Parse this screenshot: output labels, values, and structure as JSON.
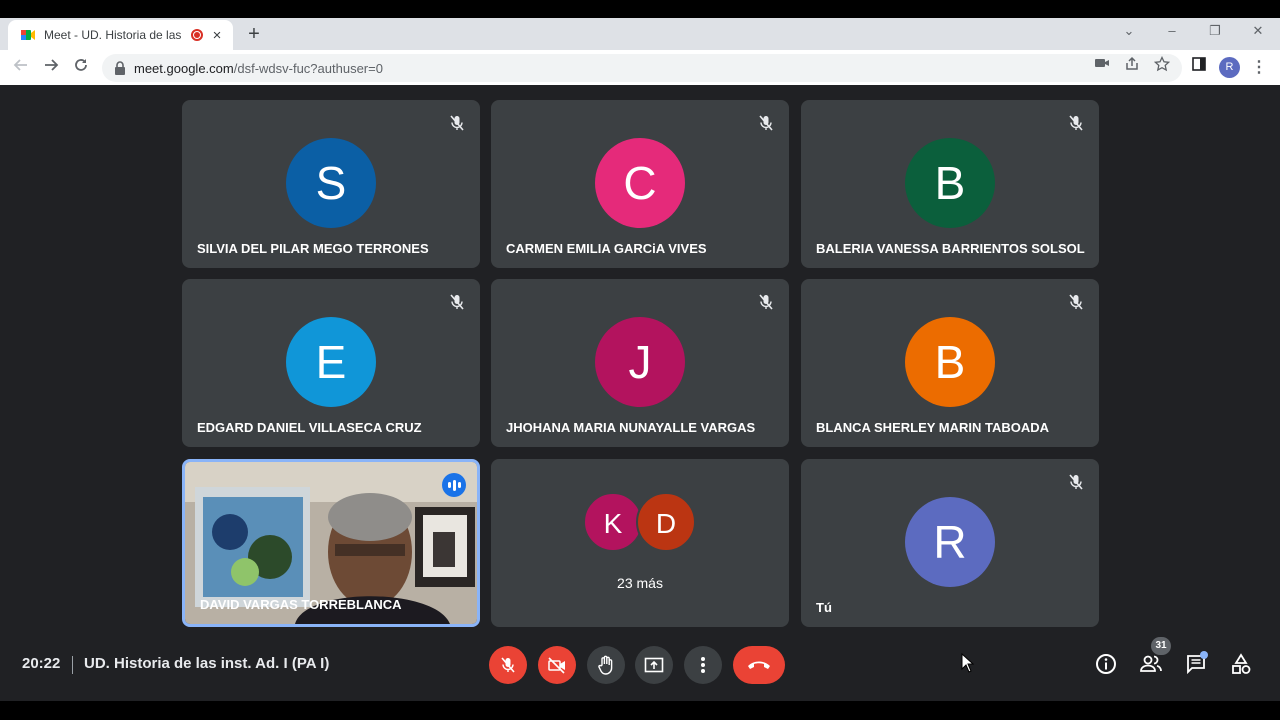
{
  "browser": {
    "tab_title": "Meet - UD. Historia de las in",
    "tab_close": "×",
    "new_tab": "+",
    "url_host": "meet.google.com",
    "url_path": "/dsf-wdsv-fuc?authuser=0",
    "profile_initial": "R",
    "window_controls": [
      "⌄",
      "–",
      "❐",
      "✕"
    ]
  },
  "participants": [
    {
      "name": "SILVIA DEL PILAR MEGO TERRONES",
      "initial": "S",
      "color": "#0b5fa5",
      "muted": true
    },
    {
      "name": "CARMEN EMILIA GARCiA VIVES",
      "initial": "C",
      "color": "#e52a7a",
      "muted": true
    },
    {
      "name": "BALERIA VANESSA BARRIENTOS SOLSOL",
      "initial": "B",
      "color": "#0b5f3c",
      "muted": true
    },
    {
      "name": "EDGARD DANIEL VILLASECA CRUZ",
      "initial": "E",
      "color": "#1096d8",
      "muted": true
    },
    {
      "name": "JHOHANA MARIA NUNAYALLE VARGAS",
      "initial": "J",
      "color": "#b3135e",
      "muted": true
    },
    {
      "name": "BLANCA SHERLEY MARIN TABOADA",
      "initial": "B",
      "color": "#ec6c00",
      "muted": true
    }
  ],
  "speaker": {
    "name": "DAVID VARGAS TORREBLANCA"
  },
  "others": {
    "initials": [
      "K",
      "D"
    ],
    "colors": [
      "#b3135e",
      "#bb3512"
    ],
    "label": "23 más"
  },
  "self": {
    "name": "Tú",
    "initial": "R",
    "color": "#5c6bc0"
  },
  "meeting": {
    "time": "20:22",
    "title": "UD. Historia de las inst. Ad. I (PA I)"
  },
  "people_count": "31",
  "colors": {
    "end_call": "#ea4335",
    "tile": "#3c4043",
    "background": "#202124",
    "speaking_border": "#8ab4f8"
  }
}
